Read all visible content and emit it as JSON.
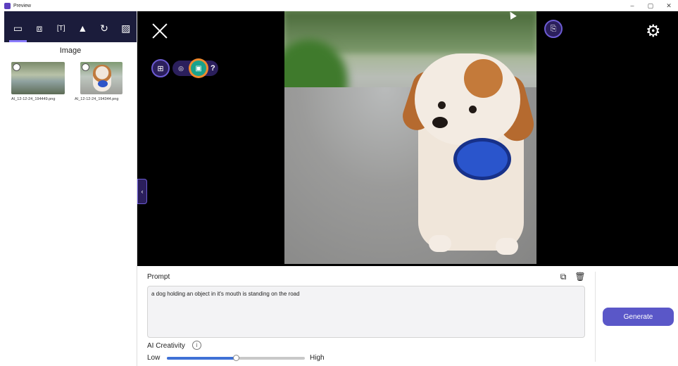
{
  "window": {
    "title": "Preview",
    "controls": [
      "–",
      "▢",
      "✕"
    ]
  },
  "left_pane": {
    "tabs": [
      {
        "icon": "image-icon",
        "glyph": "▭"
      },
      {
        "icon": "video-icon",
        "glyph": "⧈"
      },
      {
        "icon": "text-capture-icon",
        "glyph": "[T]"
      },
      {
        "icon": "drive-icon",
        "glyph": "▲"
      },
      {
        "icon": "refresh-icon",
        "glyph": "↻"
      },
      {
        "icon": "gallery-icon",
        "glyph": "▨"
      }
    ],
    "title": "Image",
    "thumbnails": [
      {
        "filename": "AI_12-12-24_194449.png"
      },
      {
        "filename": "AI_12-12-24_194344.png"
      }
    ]
  },
  "viewer": {
    "close_glyph": "",
    "tool_add_glyph": "⊞",
    "tool_camera_glyph": "◎",
    "tool_image_glyph": "▣",
    "tool_help_glyph": "?",
    "save_glyph": "⎘",
    "gear_glyph": "⚙",
    "collapse_glyph": "‹"
  },
  "prompt_panel": {
    "label": "Prompt",
    "copy_glyph": "⧉",
    "trash_glyph": "🗑",
    "text": "a dog holding an object in it's mouth is standing on the road",
    "generate_label": "Generate",
    "creativity_label": "AI Creativity",
    "info_glyph": "i",
    "low_label": "Low",
    "high_label": "High",
    "creativity_level": 0.5
  },
  "colors": {
    "accent": "#5a57c8",
    "tab_bar": "#1b1c3b",
    "tool_bg": "#2b1f5c",
    "tool_border": "#6c5bd3",
    "selected_ring": "#f08a2c",
    "slider_fill": "#3f71d6"
  }
}
